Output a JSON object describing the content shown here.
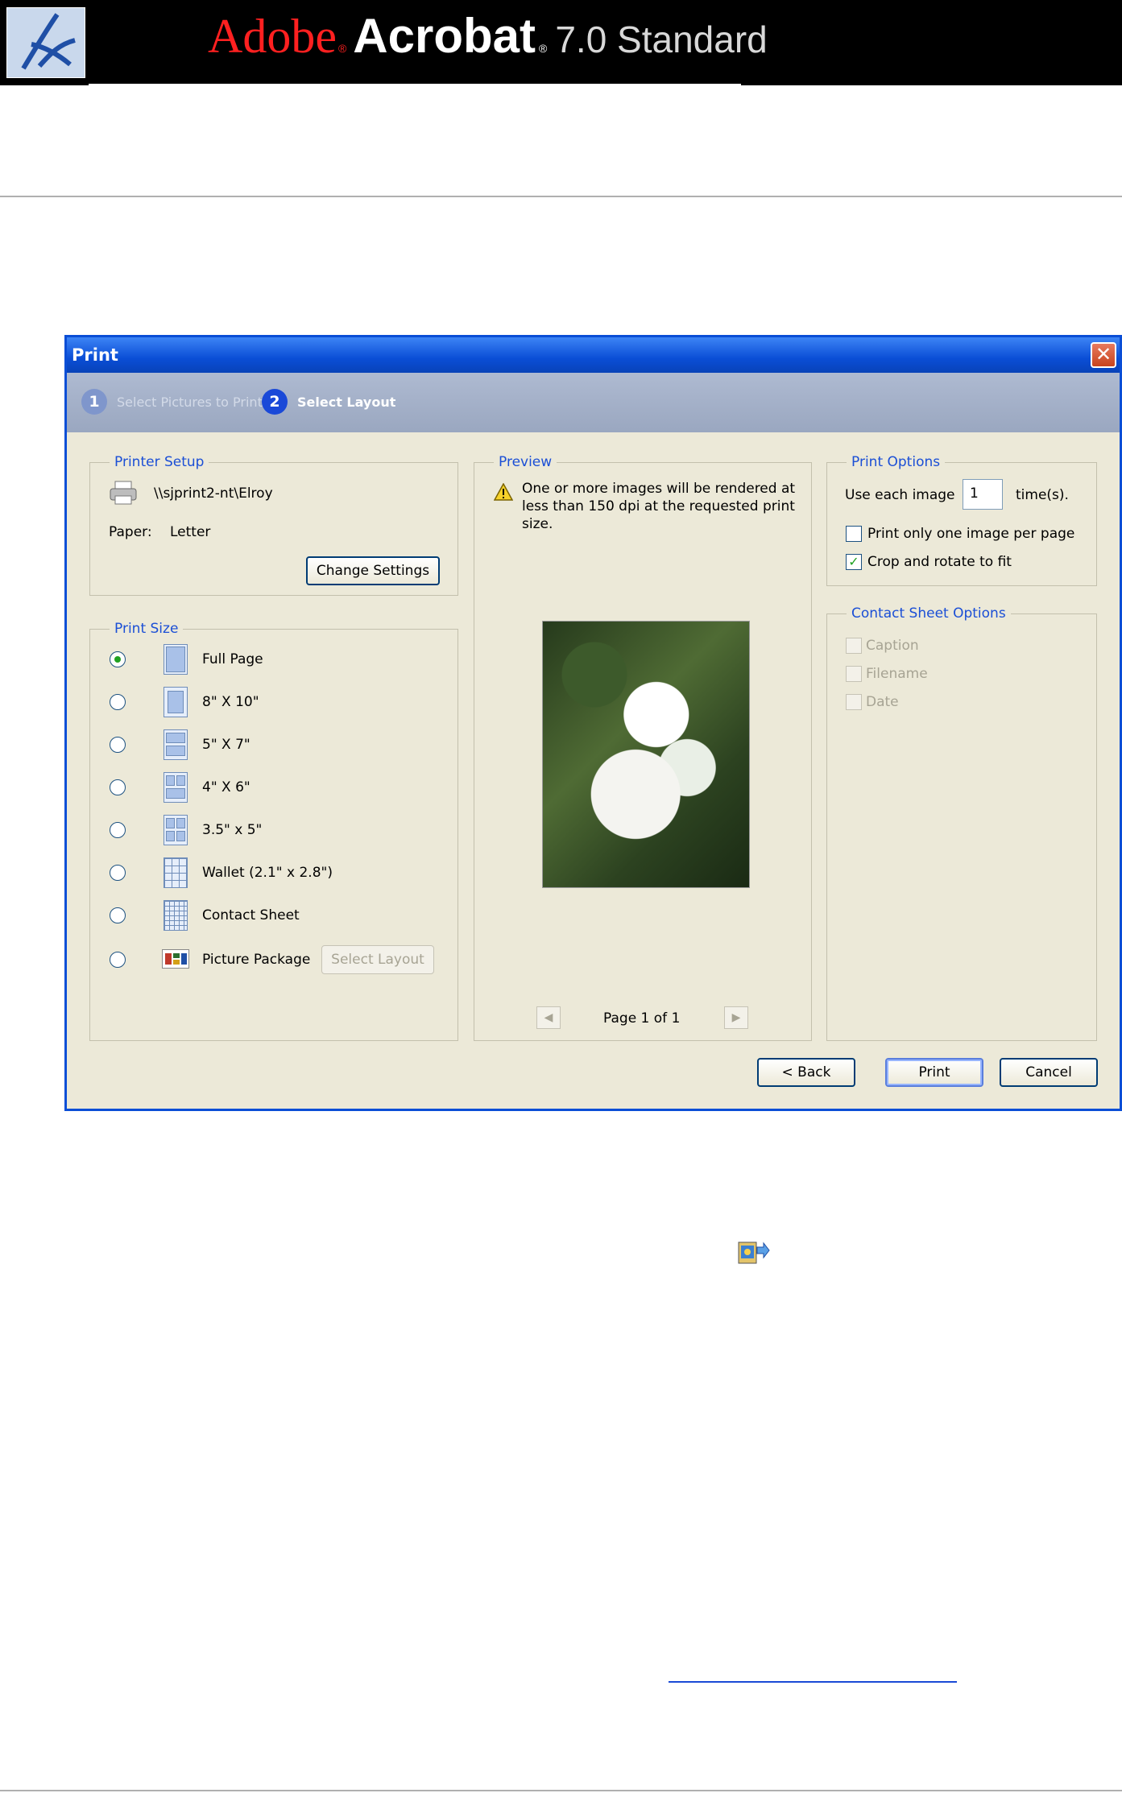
{
  "banner": {
    "adobe": "Adobe",
    "reg1": "®",
    "acrobat": "Acrobat",
    "reg2": "®",
    "version": "7.0 Standard"
  },
  "dialog": {
    "title": "Print",
    "close_glyph": "✕",
    "steps": [
      {
        "num": "1",
        "label": "Select Pictures to Print"
      },
      {
        "num": "2",
        "label": "Select Layout"
      }
    ],
    "printer_setup": {
      "legend": "Printer Setup",
      "printer_name": "\\\\sjprint2-nt\\Elroy",
      "paper_label": "Paper:",
      "paper_value": "Letter",
      "change_settings": "Change Settings"
    },
    "print_size": {
      "legend": "Print Size",
      "options": [
        {
          "label": "Full Page",
          "checked": true
        },
        {
          "label": "8\" X 10\"",
          "checked": false
        },
        {
          "label": "5\" X 7\"",
          "checked": false
        },
        {
          "label": "4\" X 6\"",
          "checked": false
        },
        {
          "label": "3.5\" x 5\"",
          "checked": false
        },
        {
          "label": "Wallet (2.1\" x 2.8\")",
          "checked": false
        },
        {
          "label": "Contact Sheet",
          "checked": false
        },
        {
          "label": "Picture Package",
          "checked": false
        }
      ],
      "select_layout": "Select Layout"
    },
    "preview": {
      "legend": "Preview",
      "warning": "One or more images will be rendered at less than 150 dpi at the requested print size.",
      "page_label": "Page 1 of 1"
    },
    "print_options": {
      "legend": "Print Options",
      "use_each_image": "Use each image",
      "times_value": "1",
      "times_label": "time(s).",
      "one_per_page": {
        "label": "Print only one image per page",
        "checked": false
      },
      "crop_rotate": {
        "label": "Crop and rotate to fit",
        "checked": true
      }
    },
    "contact_sheet_options": {
      "legend": "Contact Sheet Options",
      "caption": "Caption",
      "filename": "Filename",
      "date": "Date"
    },
    "buttons": {
      "back": "< Back",
      "print": "Print",
      "cancel": "Cancel"
    }
  },
  "colors": {
    "banner_bg": "#000000",
    "adobe_red": "#ff2020",
    "dialog_bg": "#ece9d8",
    "title_blue": "#0a4ed6",
    "legend_blue": "#1b4fd6"
  }
}
